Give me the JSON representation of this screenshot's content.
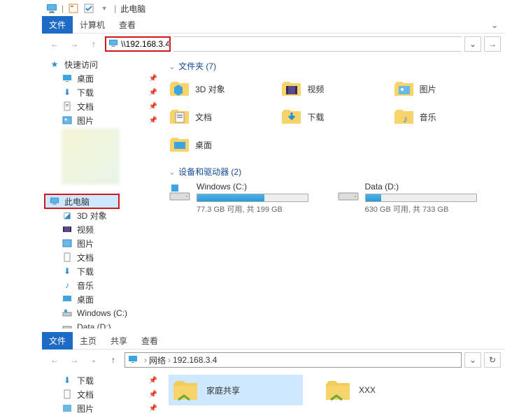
{
  "titlebar": {
    "title": "此电脑"
  },
  "ribbon": {
    "file": "文件",
    "computer": "计算机",
    "view": "查看"
  },
  "addr1": {
    "value": "\\\\192.168.3.4"
  },
  "sidebar1": {
    "quick": "快速访问",
    "desktop": "桌面",
    "downloads": "下载",
    "documents": "文档",
    "pictures": "图片",
    "thisPC": "此电脑",
    "objects3d": "3D 对象",
    "videos": "视频",
    "music": "音乐",
    "winC": "Windows (C:)",
    "dataD": "Data (D:)"
  },
  "main": {
    "group_folders": "文件夹 (7)",
    "group_drives": "设备和驱动器 (2)",
    "folders": {
      "objects3d": "3D 对象",
      "videos": "视频",
      "pictures": "图片",
      "documents": "文档",
      "downloads": "下载",
      "music": "音乐",
      "desktop": "桌面"
    },
    "drives": {
      "c": {
        "name": "Windows (C:)",
        "stat": "77.3 GB 可用, 共 199 GB",
        "pct": 61
      },
      "d": {
        "name": "Data (D:)",
        "stat": "630 GB 可用, 共 733 GB",
        "pct": 14
      }
    }
  },
  "ribbon2": {
    "file": "文件",
    "home": "主页",
    "share": "共享",
    "view": "查看"
  },
  "addr2": {
    "crumb_net": "网络",
    "crumb_ip": "192.168.3.4"
  },
  "sidebar2": {
    "downloads": "下载",
    "documents": "文档",
    "pictures": "图片"
  },
  "net": {
    "share1": "家庭共享",
    "share2": "XXX"
  }
}
